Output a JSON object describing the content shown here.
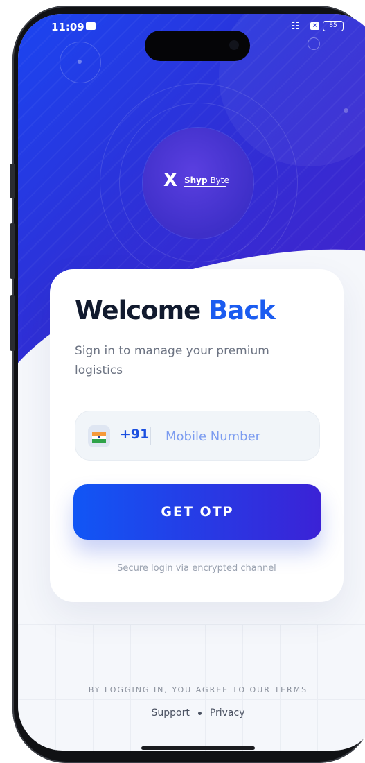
{
  "status_bar": {
    "time": "11:09",
    "battery": "85"
  },
  "brand": {
    "logo_mark": "X",
    "logo_name_bold": "Shyp",
    "logo_name_light": "Byte"
  },
  "login": {
    "title_dark": "Welcome",
    "title_accent": "Back",
    "subtitle": "Sign in to manage your premium logistics",
    "country_code": "+91",
    "flag_icon": "india-flag-icon",
    "mobile_placeholder": "Mobile Number",
    "mobile_value": "",
    "otp_button_label": "GET OTP",
    "secure_note": "Secure login via encrypted channel"
  },
  "footer": {
    "terms": "BY LOGGING IN, YOU AGREE TO OUR TERMS",
    "support_label": "Support",
    "privacy_label": "Privacy"
  },
  "colors": {
    "primary": "#1B5CF0",
    "hero_start": "#1B45F0",
    "hero_end": "#4A1FC8",
    "title": "#111A2E"
  }
}
